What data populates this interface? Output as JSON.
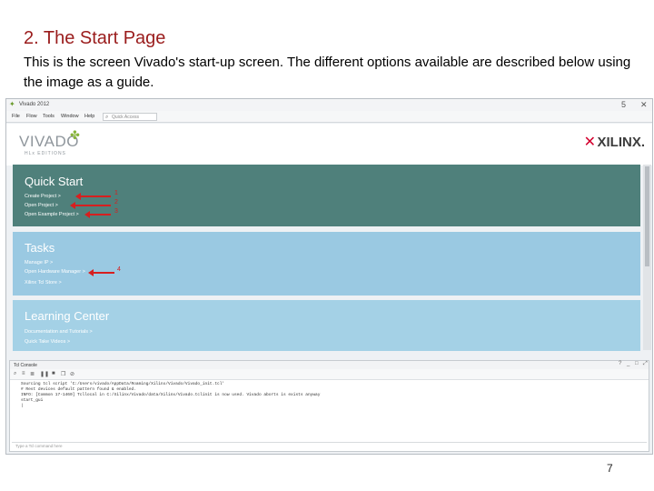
{
  "slide": {
    "title": "2. The Start Page",
    "body": "This is the screen Vivado's start-up screen. The different options available are described below using the image as a guide.",
    "page_number": "7"
  },
  "window": {
    "title": "Vivado 2012",
    "controls": [
      "5",
      "✕"
    ]
  },
  "menu": {
    "items": [
      "File",
      "Flow",
      "Tools",
      "Window",
      "Help"
    ],
    "quick_access_placeholder": "Quick Access"
  },
  "header": {
    "product": "VIVADO",
    "product_sub": "HLx EDITIONS",
    "brand": "XILINX."
  },
  "quick_start": {
    "title": "Quick Start",
    "links": [
      "Create Project >",
      "Open Project >",
      "Open Example Project >"
    ],
    "markers": [
      "1",
      "2",
      "3"
    ]
  },
  "tasks": {
    "title": "Tasks",
    "links": [
      "Manage IP >",
      "Open Hardware Manager >",
      "Xilinx Tcl Store >"
    ],
    "marker": "4"
  },
  "learning_center": {
    "title": "Learning Center",
    "links": [
      "Documentation and Tutorials >",
      "Quick Take Videos >"
    ]
  },
  "tcl_console": {
    "title": "Tcl Console",
    "header_controls": [
      "?",
      "_",
      "□",
      "⤢"
    ],
    "lines": [
      "Sourcing tcl script 'C:/Users/vivado/AppData/Roaming/Xilinx/Vivado/Vivado_init.tcl'",
      "# Rest devices default pattern found & enabled.",
      "INFO: [Common 17-1460] Tcllocal in C:/Xilinx/Vivado/data/Xilinx/Vivado.tclinit is now used. Vivado aborts is exists anyway",
      "start_gui",
      "|"
    ],
    "command_placeholder": "Type a Tcl command here"
  },
  "colors": {
    "quick_start_bg": "#4f807b",
    "tasks_bg": "#9ac9e2",
    "learning_bg": "#a4d1e6",
    "annotation_red": "#d71f1f",
    "title_red": "#9a1c1c"
  }
}
